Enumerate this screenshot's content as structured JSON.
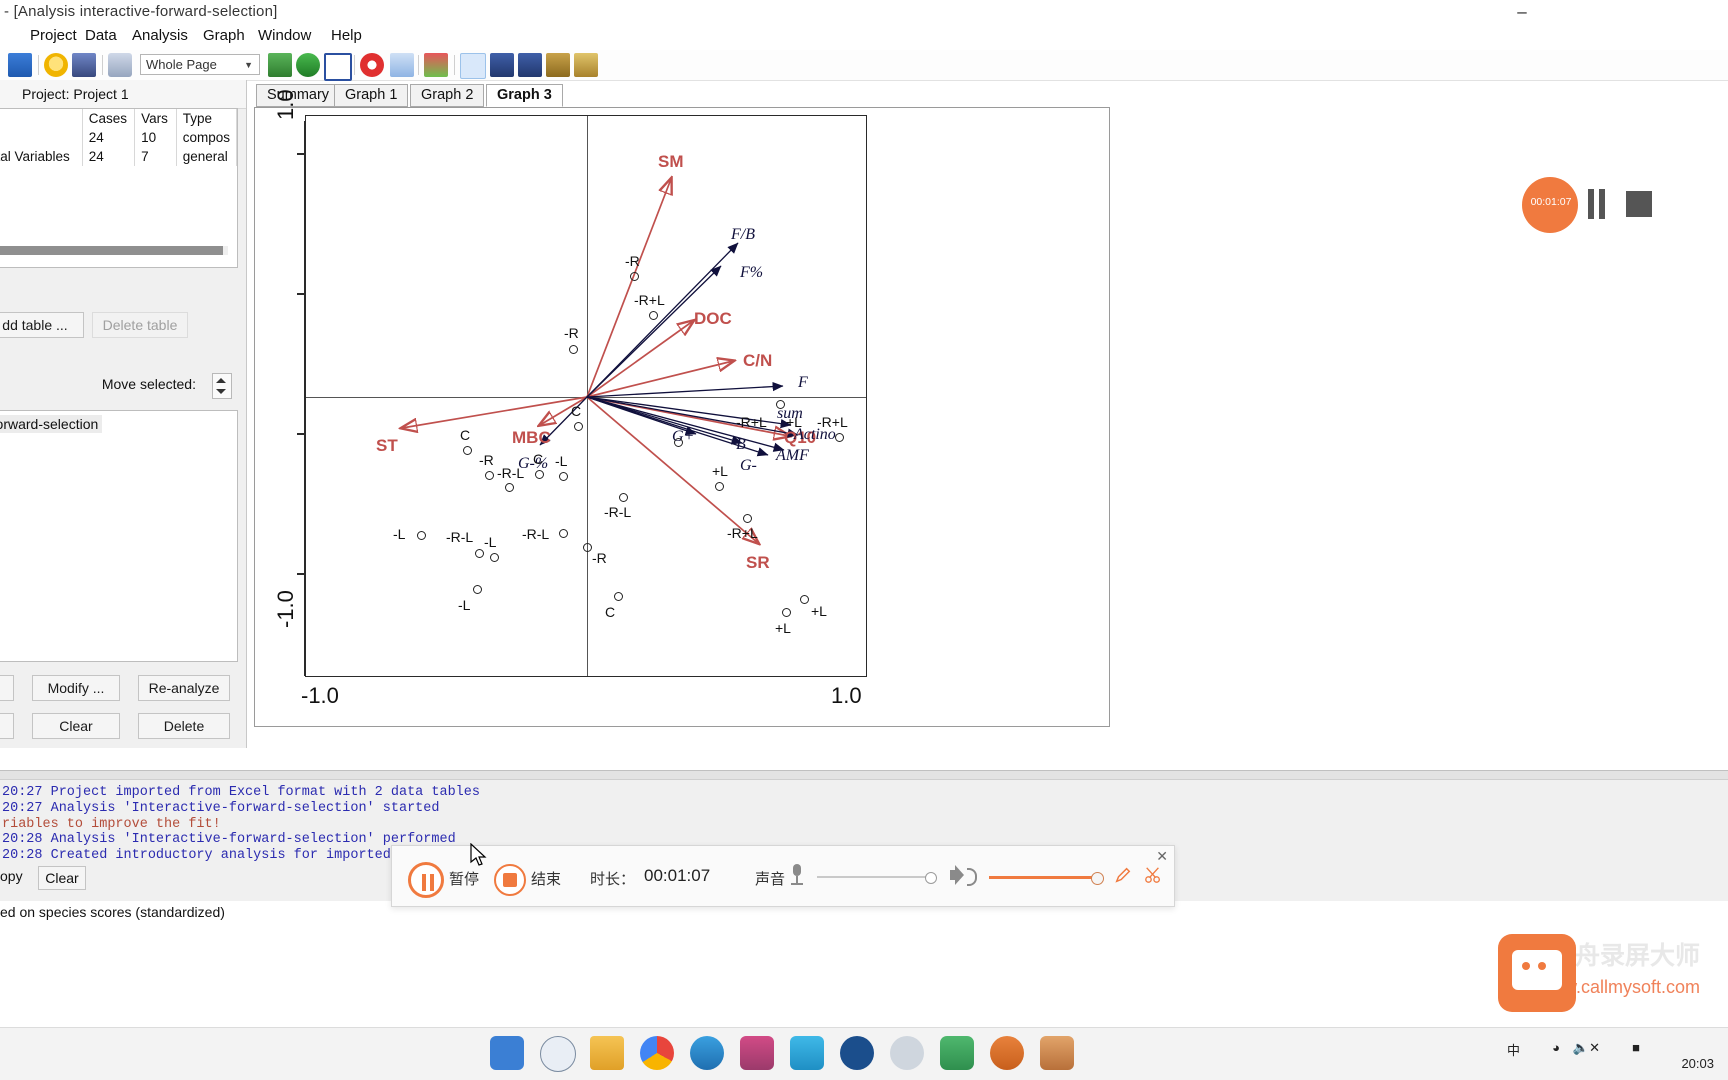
{
  "window": {
    "title": "- [Analysis interactive-forward-selection]",
    "minimize_icon": "minimize-icon"
  },
  "menubar": {
    "items": [
      "Project",
      "Data",
      "Analysis",
      "Graph",
      "Window",
      "Help"
    ]
  },
  "toolbar": {
    "combo_value": "Whole Page",
    "combo_arrow": "chevron-down-icon",
    "icons": [
      "save-icon",
      "wizard-icon",
      "ruler-icon",
      "print-preview-icon",
      "new-graph-icon",
      "refresh-icon",
      "table-icon",
      "lifebuoy-icon",
      "help-arrow-icon",
      "font-color-icon",
      "pointer-icon",
      "add-point-icon",
      "add-label-icon",
      "divider-icon",
      "highlight-icon"
    ]
  },
  "left_panel": {
    "project_header": "Project: Project 1",
    "table": {
      "columns": [
        "",
        "Cases",
        "Vars",
        "Type"
      ],
      "rows": [
        [
          "",
          "24",
          "10",
          "compos"
        ],
        [
          "ntal Variables",
          "24",
          "7",
          "general"
        ]
      ]
    },
    "add_table_button": "dd table ...",
    "delete_table_button": "Delete table",
    "move_selected_label": "Move selected:",
    "list_selected_item": "-forward-selection",
    "buttons": {
      "modify": "Modify ...",
      "reanalyze": "Re-analyze",
      "clear": "Clear",
      "delete": "Delete"
    }
  },
  "graph_window": {
    "tabs": [
      {
        "label": "Summary",
        "active": false
      },
      {
        "label": "Graph 1",
        "active": false
      },
      {
        "label": "Graph 2",
        "active": false
      },
      {
        "label": "Graph 3",
        "active": true
      }
    ]
  },
  "recorder": {
    "time": "00:01:07",
    "pause_icon": "pause-icon",
    "stop_icon": "stop-icon"
  },
  "console": {
    "lines": [
      {
        "text": "20:27 Project imported from Excel format with 2 data tables",
        "color": "blue"
      },
      {
        "text": "20:27 Analysis 'Interactive-forward-selection' started",
        "color": "blue"
      },
      {
        "text": "riables to improve the fit!",
        "color": "red"
      },
      {
        "text": "20:28 Analysis 'Interactive-forward-selection' performed",
        "color": "blue"
      },
      {
        "text": "20:28 Created introductory analysis for imported",
        "color": "blue"
      }
    ]
  },
  "bottom_left": {
    "copy_label": "opy",
    "clear_button": "Clear",
    "status": "ed on species scores (standardized)"
  },
  "media_bar": {
    "pause_label": "暂停",
    "stop_label": "结束",
    "duration_label": "时长：",
    "duration_value": "00:01:07",
    "volume_label": "声音",
    "close_icon": "close-icon",
    "mic_icon": "microphone-icon",
    "speaker_icon": "speaker-icon",
    "pen_icon": "pen-icon",
    "scissors_icon": "scissors-icon"
  },
  "watermark": {
    "line1": "金舟录屏大师",
    "line2": "www.callmysoft.com"
  },
  "taskbar": {
    "icons": [
      "windows-start-icon",
      "search-icon",
      "file-explorer-icon",
      "chrome-icon",
      "edge-icon",
      "app-icon",
      "cloud-icon",
      "dell-icon",
      "settings-icon",
      "recorder-icon",
      "magnifier-icon",
      "store-icon"
    ],
    "tray": {
      "ime": "中",
      "wifi_icon": "wifi-icon",
      "volume_icon": "volume-mute-icon",
      "battery_icon": "battery-icon",
      "clock": "20:03"
    }
  },
  "chart_data": {
    "type": "scatter",
    "title": "",
    "xlabel": "",
    "ylabel": "",
    "xlim": [
      -1.0,
      1.0
    ],
    "ylim": [
      -1.0,
      1.0
    ],
    "x_ticks": [
      "-1.0",
      "1.0"
    ],
    "y_ticks": [
      "1.0",
      "-1.0"
    ],
    "grid": false,
    "legend": "none",
    "axis_labels": {
      "x_left": "-1.0",
      "x_right": "1.0",
      "y_top": "1.0",
      "y_bottom": "-1.0"
    },
    "env_vector_color": "#c0504d",
    "species_vector_color": "#10103c",
    "env_vectors": [
      {
        "label": "SM",
        "x": 0.3,
        "y": 0.78
      },
      {
        "label": "DOC",
        "x": 0.38,
        "y": 0.27
      },
      {
        "label": "C/N",
        "x": 0.52,
        "y": 0.13
      },
      {
        "label": "ST",
        "x": -0.66,
        "y": -0.11
      },
      {
        "label": "MBC",
        "x": -0.17,
        "y": -0.1
      },
      {
        "label": "SR",
        "x": 0.61,
        "y": -0.52
      },
      {
        "label": "Q10",
        "x": 0.72,
        "y": -0.14
      }
    ],
    "species_vectors": [
      {
        "label": "F/B",
        "x": 0.54,
        "y": 0.55
      },
      {
        "label": "F%",
        "x": 0.48,
        "y": 0.47
      },
      {
        "label": "F",
        "x": 0.7,
        "y": 0.04
      },
      {
        "label": "sum",
        "x": 0.72,
        "y": -0.1
      },
      {
        "label": "Actino",
        "x": 0.74,
        "y": -0.14
      },
      {
        "label": "AMF",
        "x": 0.7,
        "y": -0.2
      },
      {
        "label": "B",
        "x": 0.55,
        "y": -0.16
      },
      {
        "label": "G+",
        "x": 0.35,
        "y": -0.13
      },
      {
        "label": "G-",
        "x": 0.6,
        "y": -0.21
      },
      {
        "label": "G-%",
        "x": -0.17,
        "y": -0.17
      }
    ],
    "sample_points": [
      {
        "label": "-R",
        "x": 0.04,
        "y": 0.92,
        "label_pos": "top"
      },
      {
        "label": "-R+L",
        "x": 0.11,
        "y": 0.78,
        "label_pos": "top"
      },
      {
        "label": "-R",
        "x": -0.05,
        "y": 0.62,
        "label_pos": "top"
      },
      {
        "label": "C",
        "x": -0.03,
        "y": 0.35,
        "label_pos": "top"
      },
      {
        "label": "C",
        "x": -0.43,
        "y": 0.3,
        "label_pos": "top"
      },
      {
        "label": "-R",
        "x": -0.36,
        "y": 0.19,
        "label_pos": "topleft"
      },
      {
        "label": "-R-L",
        "x": -0.28,
        "y": 0.13,
        "label_pos": "top"
      },
      {
        "label": "C",
        "x": -0.16,
        "y": 0.19,
        "label_pos": "top"
      },
      {
        "label": "-L",
        "x": -0.08,
        "y": 0.17,
        "label_pos": "top"
      },
      {
        "label": "-R+L",
        "x": 0.92,
        "y": 0.32,
        "label_pos": "top"
      },
      {
        "label": "+L",
        "x": 0.5,
        "y": 0.11,
        "label_pos": "top"
      },
      {
        "label": "-L",
        "x": -0.82,
        "y": -0.02,
        "label_pos": "left"
      },
      {
        "label": "-R-L",
        "x": -0.59,
        "y": -0.06,
        "label_pos": "topleft"
      },
      {
        "label": "-L",
        "x": -0.53,
        "y": -0.07,
        "label_pos": "top"
      },
      {
        "label": "-R-L",
        "x": -0.28,
        "y": -0.02,
        "label_pos": "left"
      },
      {
        "label": "-R",
        "x": -0.04,
        "y": -0.08,
        "label_pos": "right"
      },
      {
        "label": "+L",
        "x": 0.47,
        "y": -0.02,
        "label_pos": "bottom"
      },
      {
        "label": "-R+L",
        "x": 0.32,
        "y": -0.11,
        "label_pos": "bottom"
      },
      {
        "label": "-R-L",
        "x": -0.06,
        "y": -0.32,
        "label_pos": "bottom"
      },
      {
        "label": "-R+L",
        "x": 0.37,
        "y": -0.41,
        "label_pos": "bottom"
      },
      {
        "label": "-L",
        "x": -0.64,
        "y": -0.67,
        "label_pos": "bottom"
      },
      {
        "label": "C",
        "x": -0.14,
        "y": -0.71,
        "label_pos": "bottom"
      },
      {
        "label": "+L",
        "x": 0.52,
        "y": -0.72,
        "label_pos": "right"
      },
      {
        "label": "+L",
        "x": 0.45,
        "y": -0.76,
        "label_pos": "bottom"
      }
    ]
  }
}
